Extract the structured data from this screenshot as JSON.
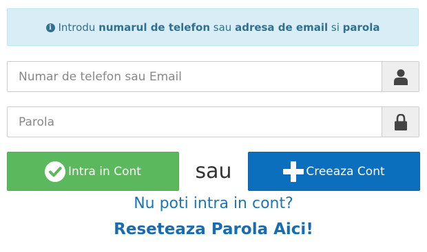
{
  "alert": {
    "icon": "info-circle-icon",
    "text_intro": "Introdu",
    "text_phone": "numarul de telefon",
    "text_or": "sau",
    "text_email": "adresa de email",
    "text_and": "si",
    "text_password": "parola",
    "background": "#d9edf7",
    "color": "#31708f"
  },
  "login_field": {
    "value": "",
    "placeholder": "Numar de telefon sau Email",
    "icon": "user-icon"
  },
  "password_field": {
    "value": "",
    "placeholder": "Parola",
    "icon": "lock-icon"
  },
  "login_button": {
    "label": "Intra in Cont",
    "icon": "check-circle-icon",
    "color": "#5cb85c"
  },
  "separator": {
    "text": "sau"
  },
  "create_button": {
    "label": "Creeaza Cont",
    "icon": "plus-icon",
    "color": "#0b6fbd"
  },
  "forgot": {
    "question": "Nu poti intra in cont?",
    "reset_link": "Reseteaza Parola Aici!"
  }
}
